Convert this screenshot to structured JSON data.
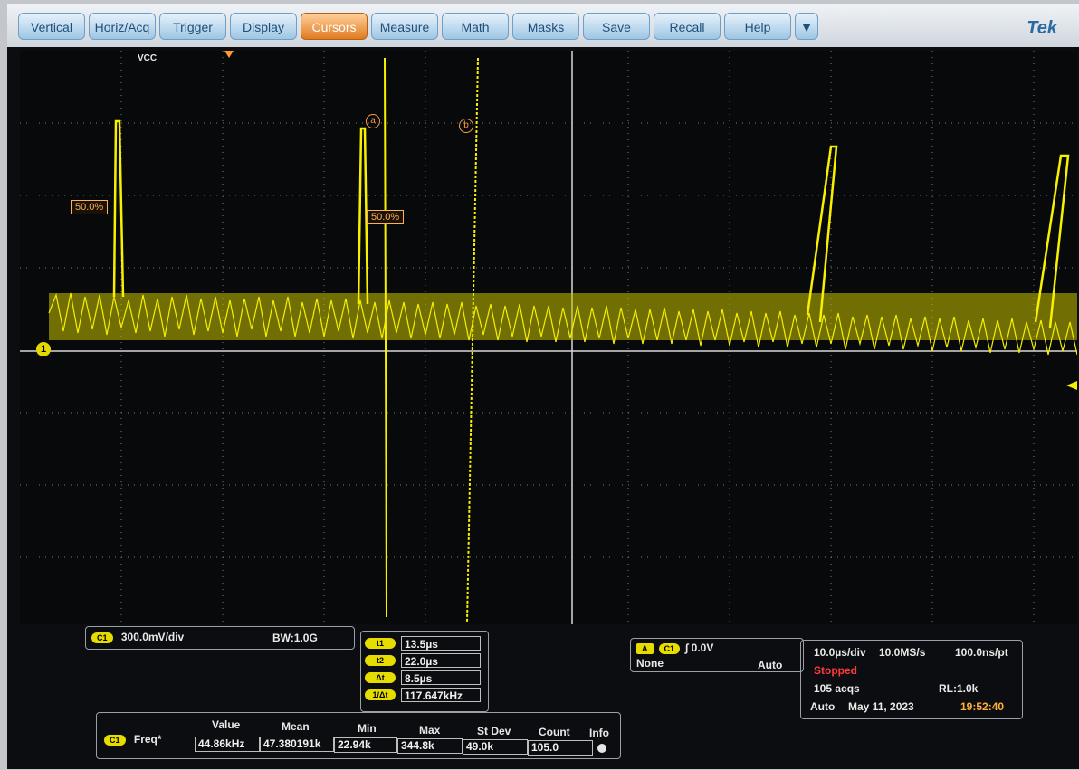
{
  "menu": {
    "items": [
      "Vertical",
      "Horiz/Acq",
      "Trigger",
      "Display",
      "Cursors",
      "Measure",
      "Math",
      "Masks",
      "Save",
      "Recall",
      "Help"
    ],
    "more": "▼",
    "brand": "Tek"
  },
  "waveform": {
    "vcc_label": "VCC",
    "marker_a": "a",
    "marker_b": "b",
    "level_left": "50.0%",
    "level_right": "50.0%",
    "channel_marker": "1"
  },
  "channel": {
    "badge": "C1",
    "scale": "300.0mV/div",
    "bandwidth": "BW:1.0G"
  },
  "cursors": {
    "rows": [
      {
        "label": "t1",
        "value": "13.5µs"
      },
      {
        "label": "t2",
        "value": "22.0µs"
      },
      {
        "label": "Δt",
        "value": "8.5µs"
      },
      {
        "label": "1/Δt",
        "value": "117.647kHz"
      }
    ]
  },
  "trigger": {
    "badge_a": "A",
    "badge_ch": "C1",
    "slope": "∫",
    "level": "0.0V",
    "coupling": "None",
    "mode": "Auto"
  },
  "acq": {
    "timebase": "10.0µs/div",
    "sample_rate": "10.0MS/s",
    "resolution": "100.0ns/pt",
    "status": "Stopped",
    "acqs": "105 acqs",
    "record_length": "RL:1.0k",
    "mode": "Auto",
    "date": "May 11, 2023",
    "time": "19:52:40"
  },
  "measurement": {
    "badge": "C1",
    "name": "Freq*",
    "headers": [
      "Value",
      "Mean",
      "Min",
      "Max",
      "St Dev",
      "Count",
      "Info"
    ],
    "values": [
      "44.86kHz",
      "47.380191k",
      "22.94k",
      "344.8k",
      "49.0k",
      "105.0"
    ]
  }
}
